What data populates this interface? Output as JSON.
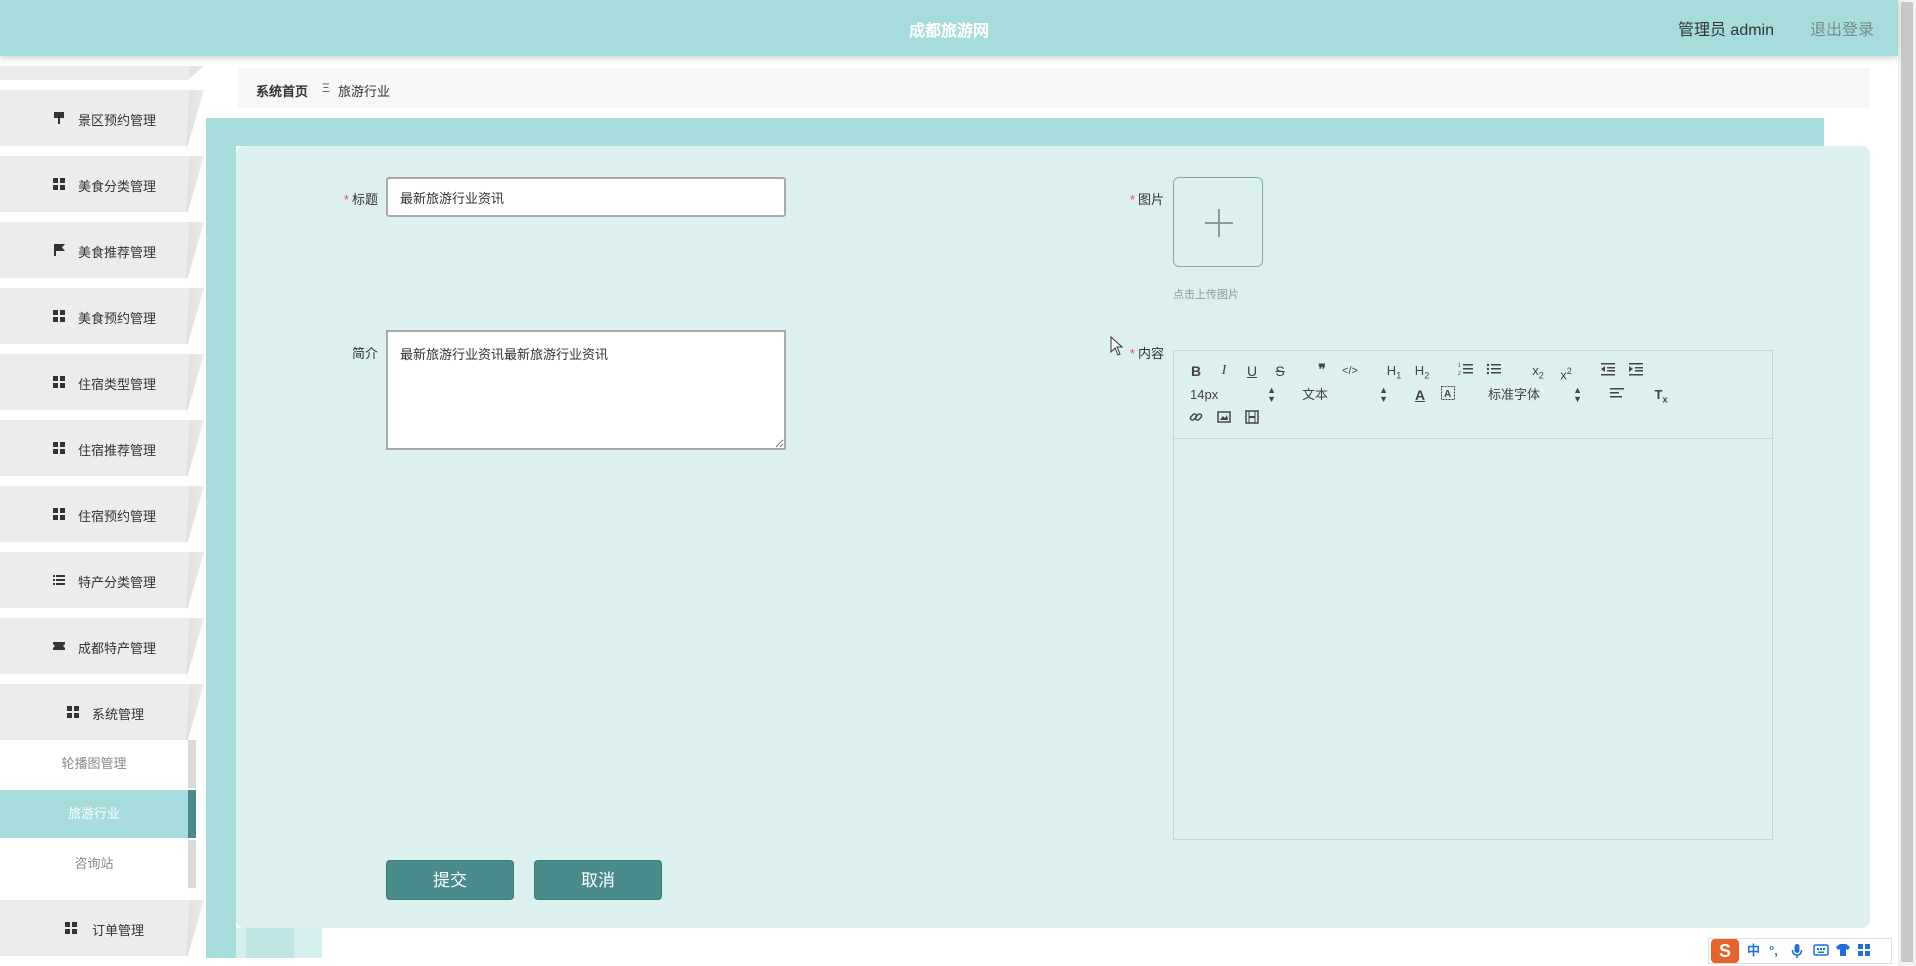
{
  "header": {
    "title": "成都旅游网",
    "user": "管理员 admin",
    "logout": "退出登录",
    "color": "#a6dcdc"
  },
  "sidebar": {
    "items": [
      {
        "label": "景区预约管理",
        "icon": "stamp-icon"
      },
      {
        "label": "美食分类管理",
        "icon": "grid-icon"
      },
      {
        "label": "美食推荐管理",
        "icon": "flag-icon"
      },
      {
        "label": "美食预约管理",
        "icon": "grid-icon"
      },
      {
        "label": "住宿类型管理",
        "icon": "grid-icon"
      },
      {
        "label": "住宿推荐管理",
        "icon": "grid-icon"
      },
      {
        "label": "住宿预约管理",
        "icon": "grid-icon"
      },
      {
        "label": "特产分类管理",
        "icon": "list-icon"
      },
      {
        "label": "成都特产管理",
        "icon": "ticket-icon"
      },
      {
        "label": "系统管理",
        "icon": "grid-icon"
      }
    ],
    "sub_items": [
      {
        "label": "轮播图管理",
        "active": false
      },
      {
        "label": "旅游行业",
        "active": true
      },
      {
        "label": "咨询站",
        "active": false
      }
    ],
    "last_item": {
      "label": "订单管理",
      "icon": "grid-icon"
    }
  },
  "breadcrumb": {
    "home": "系统首页",
    "separator": "Ξ",
    "current": "旅游行业"
  },
  "form": {
    "title_label": "标题",
    "title_value": "最新旅游行业资讯",
    "summary_label": "简介",
    "summary_value": "最新旅游行业资讯最新旅游行业资讯",
    "image_label": "图片",
    "image_hint": "点击上传图片",
    "content_label": "内容",
    "required_mark": "*",
    "editor": {
      "font_size": "14px",
      "block_type": "文本",
      "font_family": "标准字体"
    },
    "submit": "提交",
    "cancel": "取消"
  },
  "ime": {
    "logo": "S",
    "mode": "中",
    "punct": "°,"
  },
  "colors": {
    "accent": "#a6dcdc",
    "panel": "#dcf0f0",
    "button": "#4a8c8c",
    "required": "#e6504c"
  }
}
